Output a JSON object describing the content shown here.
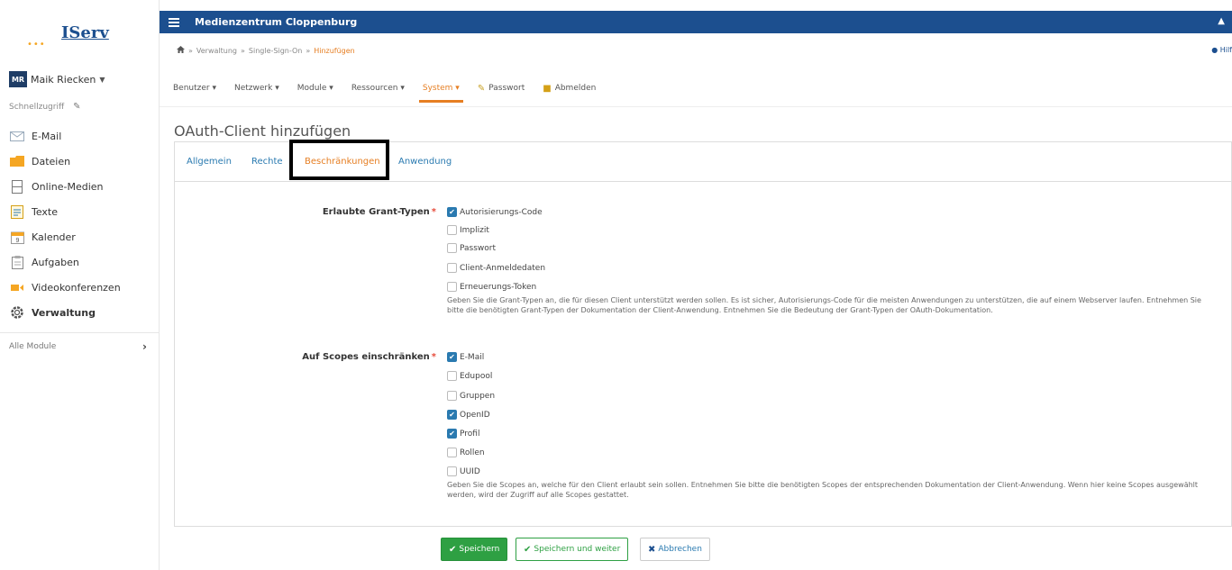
{
  "sidebar": {
    "logo": "IServ",
    "user": {
      "initials": "MR",
      "name": "Maik Riecken"
    },
    "quick_access": "Schnellzugriff",
    "items": [
      {
        "label": "E-Mail",
        "icon": "mail-icon"
      },
      {
        "label": "Dateien",
        "icon": "folder-icon"
      },
      {
        "label": "Online-Medien",
        "icon": "film-icon"
      },
      {
        "label": "Texte",
        "icon": "document-icon"
      },
      {
        "label": "Kalender",
        "icon": "calendar-icon"
      },
      {
        "label": "Aufgaben",
        "icon": "clipboard-icon"
      },
      {
        "label": "Videokonferenzen",
        "icon": "video-icon"
      },
      {
        "label": "Verwaltung",
        "icon": "gear-icon"
      }
    ],
    "all_modules": "Alle Module"
  },
  "topbar": {
    "title": "Medienzentrum Cloppenburg"
  },
  "breadcrumb": {
    "items": [
      "Verwaltung",
      "Single-Sign-On"
    ],
    "current": "Hinzufügen",
    "help": "Hilf"
  },
  "mainmenu": {
    "items": [
      {
        "label": "Benutzer ▾"
      },
      {
        "label": "Netzwerk ▾"
      },
      {
        "label": "Module ▾"
      },
      {
        "label": "Ressourcen ▾"
      },
      {
        "label": "System ▾",
        "active": true
      },
      {
        "label": "Passwort"
      },
      {
        "label": "Abmelden"
      }
    ]
  },
  "page": {
    "title": "OAuth-Client hinzufügen",
    "tabs": [
      "Allgemein",
      "Rechte",
      "Beschränkungen",
      "Anwendung"
    ],
    "grant": {
      "label": "Erlaubte Grant-Typen",
      "required": "*",
      "options": [
        {
          "label": "Autorisierungs-Code",
          "checked": true
        },
        {
          "label": "Implizit",
          "checked": false
        },
        {
          "label": "Passwort",
          "checked": false
        },
        {
          "label": "Client-Anmeldedaten",
          "checked": false
        },
        {
          "label": "Erneuerungs-Token",
          "checked": false
        }
      ],
      "help": "Geben Sie die Grant-Typen an, die für diesen Client unterstützt werden sollen. Es ist sicher, Autorisierungs-Code für die meisten Anwendungen zu unterstützen, die auf einem Webserver laufen. Entnehmen Sie bitte die benötigten Grant-Typen der Dokumentation der Client-Anwendung. Entnehmen Sie die Bedeutung der Grant-Typen der OAuth-Dokumentation."
    },
    "scopes": {
      "label": "Auf Scopes einschränken",
      "required": "*",
      "options": [
        {
          "label": "E-Mail",
          "checked": true
        },
        {
          "label": "Edupool",
          "checked": false
        },
        {
          "label": "Gruppen",
          "checked": false
        },
        {
          "label": "OpenID",
          "checked": true
        },
        {
          "label": "Profil",
          "checked": true
        },
        {
          "label": "Rollen",
          "checked": false
        },
        {
          "label": "UUID",
          "checked": false
        }
      ],
      "help": "Geben Sie die Scopes an, welche für den Client erlaubt sein sollen. Entnehmen Sie bitte die benötigten Scopes der entsprechenden Dokumentation der Client-Anwendung. Wenn hier keine Scopes ausgewählt werden, wird der Zugriff auf alle Scopes gestattet."
    },
    "buttons": {
      "save": "Speichern",
      "save_next": "Speichern und weiter",
      "cancel": "Abbrechen"
    }
  },
  "colors": {
    "brand": "#1c4f8f",
    "accent": "#e67e22",
    "success": "#2ea043",
    "link": "#2a7ab0"
  }
}
